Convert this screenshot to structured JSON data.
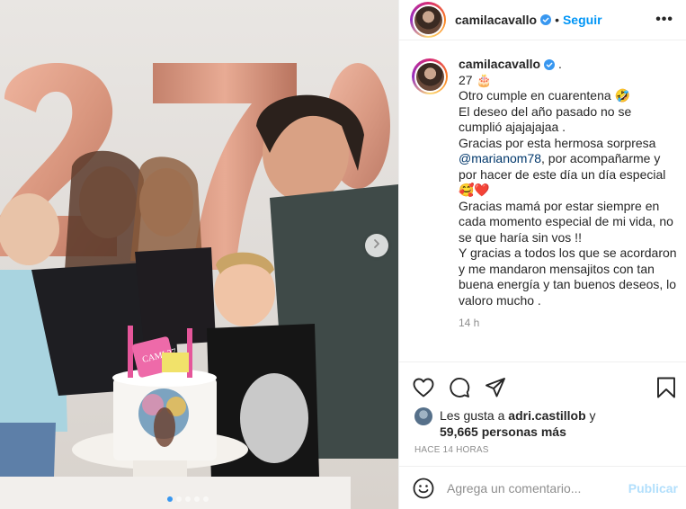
{
  "post": {
    "username": "camilacavallo",
    "follow_label": "Seguir",
    "more_label": "•••",
    "separator": "•"
  },
  "caption": {
    "username": "camilacavallo",
    "after_badge": " .",
    "lines": [
      "27 🎂",
      "Otro cumple en cuarentena 🤣",
      "El deseo del año pasado no se",
      "cumplió ajajajajaa .",
      "Gracias por esta hermosa sorpresa",
      "@marianom78",
      ", por acompañarme y",
      "por hacer de este día un día especial",
      "🥰❤️",
      "Gracias mamá por estar siempre en",
      "cada momento especial de mi vida, no",
      "se que haría sin vos !!",
      "Y gracias a todos los que se acordaron",
      "y me mandaron mensajitos con tan",
      "buena energía y tan buenos deseos, lo",
      "valoro mucho ."
    ],
    "time_ago": "14 h"
  },
  "likes": {
    "prefix": "Les gusta a ",
    "first_user": "adri.castillob",
    "connector": " y",
    "others": "59,665 personas más"
  },
  "posted_label": "HACE 14 HORAS",
  "comment": {
    "placeholder": "Agrega un comentario...",
    "publish_label": "Publicar"
  },
  "photo": {
    "balloon_numbers": [
      "2",
      "7"
    ],
    "cake_topper_text": "CAMI 27",
    "carousel_dots": 5,
    "active_dot": 0
  },
  "colors": {
    "link": "#0095f6",
    "mention": "#00376b",
    "muted": "#8e8e8e",
    "publish_disabled": "#b2dffc",
    "balloon": "#d9937a"
  },
  "icons": [
    "heart-icon",
    "comment-icon",
    "share-icon",
    "bookmark-icon",
    "emoji-icon",
    "verified-icon",
    "chevron-right-icon"
  ]
}
